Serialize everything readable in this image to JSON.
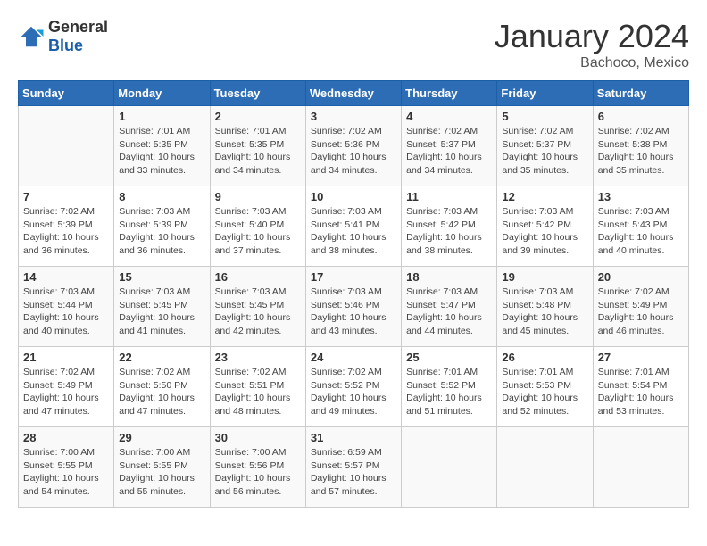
{
  "header": {
    "logo_general": "General",
    "logo_blue": "Blue",
    "month_title": "January 2024",
    "location": "Bachoco, Mexico"
  },
  "weekdays": [
    "Sunday",
    "Monday",
    "Tuesday",
    "Wednesday",
    "Thursday",
    "Friday",
    "Saturday"
  ],
  "weeks": [
    [
      {
        "day": "",
        "info": ""
      },
      {
        "day": "1",
        "info": "Sunrise: 7:01 AM\nSunset: 5:35 PM\nDaylight: 10 hours\nand 33 minutes."
      },
      {
        "day": "2",
        "info": "Sunrise: 7:01 AM\nSunset: 5:35 PM\nDaylight: 10 hours\nand 34 minutes."
      },
      {
        "day": "3",
        "info": "Sunrise: 7:02 AM\nSunset: 5:36 PM\nDaylight: 10 hours\nand 34 minutes."
      },
      {
        "day": "4",
        "info": "Sunrise: 7:02 AM\nSunset: 5:37 PM\nDaylight: 10 hours\nand 34 minutes."
      },
      {
        "day": "5",
        "info": "Sunrise: 7:02 AM\nSunset: 5:37 PM\nDaylight: 10 hours\nand 35 minutes."
      },
      {
        "day": "6",
        "info": "Sunrise: 7:02 AM\nSunset: 5:38 PM\nDaylight: 10 hours\nand 35 minutes."
      }
    ],
    [
      {
        "day": "7",
        "info": "Sunrise: 7:02 AM\nSunset: 5:39 PM\nDaylight: 10 hours\nand 36 minutes."
      },
      {
        "day": "8",
        "info": "Sunrise: 7:03 AM\nSunset: 5:39 PM\nDaylight: 10 hours\nand 36 minutes."
      },
      {
        "day": "9",
        "info": "Sunrise: 7:03 AM\nSunset: 5:40 PM\nDaylight: 10 hours\nand 37 minutes."
      },
      {
        "day": "10",
        "info": "Sunrise: 7:03 AM\nSunset: 5:41 PM\nDaylight: 10 hours\nand 38 minutes."
      },
      {
        "day": "11",
        "info": "Sunrise: 7:03 AM\nSunset: 5:42 PM\nDaylight: 10 hours\nand 38 minutes."
      },
      {
        "day": "12",
        "info": "Sunrise: 7:03 AM\nSunset: 5:42 PM\nDaylight: 10 hours\nand 39 minutes."
      },
      {
        "day": "13",
        "info": "Sunrise: 7:03 AM\nSunset: 5:43 PM\nDaylight: 10 hours\nand 40 minutes."
      }
    ],
    [
      {
        "day": "14",
        "info": "Sunrise: 7:03 AM\nSunset: 5:44 PM\nDaylight: 10 hours\nand 40 minutes."
      },
      {
        "day": "15",
        "info": "Sunrise: 7:03 AM\nSunset: 5:45 PM\nDaylight: 10 hours\nand 41 minutes."
      },
      {
        "day": "16",
        "info": "Sunrise: 7:03 AM\nSunset: 5:45 PM\nDaylight: 10 hours\nand 42 minutes."
      },
      {
        "day": "17",
        "info": "Sunrise: 7:03 AM\nSunset: 5:46 PM\nDaylight: 10 hours\nand 43 minutes."
      },
      {
        "day": "18",
        "info": "Sunrise: 7:03 AM\nSunset: 5:47 PM\nDaylight: 10 hours\nand 44 minutes."
      },
      {
        "day": "19",
        "info": "Sunrise: 7:03 AM\nSunset: 5:48 PM\nDaylight: 10 hours\nand 45 minutes."
      },
      {
        "day": "20",
        "info": "Sunrise: 7:02 AM\nSunset: 5:49 PM\nDaylight: 10 hours\nand 46 minutes."
      }
    ],
    [
      {
        "day": "21",
        "info": "Sunrise: 7:02 AM\nSunset: 5:49 PM\nDaylight: 10 hours\nand 47 minutes."
      },
      {
        "day": "22",
        "info": "Sunrise: 7:02 AM\nSunset: 5:50 PM\nDaylight: 10 hours\nand 47 minutes."
      },
      {
        "day": "23",
        "info": "Sunrise: 7:02 AM\nSunset: 5:51 PM\nDaylight: 10 hours\nand 48 minutes."
      },
      {
        "day": "24",
        "info": "Sunrise: 7:02 AM\nSunset: 5:52 PM\nDaylight: 10 hours\nand 49 minutes."
      },
      {
        "day": "25",
        "info": "Sunrise: 7:01 AM\nSunset: 5:52 PM\nDaylight: 10 hours\nand 51 minutes."
      },
      {
        "day": "26",
        "info": "Sunrise: 7:01 AM\nSunset: 5:53 PM\nDaylight: 10 hours\nand 52 minutes."
      },
      {
        "day": "27",
        "info": "Sunrise: 7:01 AM\nSunset: 5:54 PM\nDaylight: 10 hours\nand 53 minutes."
      }
    ],
    [
      {
        "day": "28",
        "info": "Sunrise: 7:00 AM\nSunset: 5:55 PM\nDaylight: 10 hours\nand 54 minutes."
      },
      {
        "day": "29",
        "info": "Sunrise: 7:00 AM\nSunset: 5:55 PM\nDaylight: 10 hours\nand 55 minutes."
      },
      {
        "day": "30",
        "info": "Sunrise: 7:00 AM\nSunset: 5:56 PM\nDaylight: 10 hours\nand 56 minutes."
      },
      {
        "day": "31",
        "info": "Sunrise: 6:59 AM\nSunset: 5:57 PM\nDaylight: 10 hours\nand 57 minutes."
      },
      {
        "day": "",
        "info": ""
      },
      {
        "day": "",
        "info": ""
      },
      {
        "day": "",
        "info": ""
      }
    ]
  ]
}
